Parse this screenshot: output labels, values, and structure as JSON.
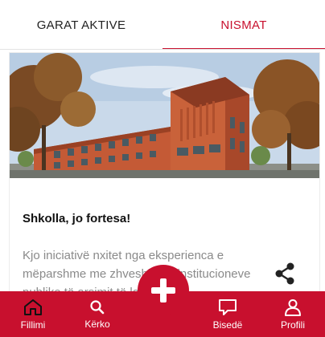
{
  "tabs": {
    "left_label": "GARAT AKTIVE",
    "right_label": "NISMAT",
    "active": "NISMAT"
  },
  "card": {
    "title": "Shkolla, jo fortesa!",
    "excerpt": "Kjo iniciativë nxitet nga eksperienca e mëparshme me zhveshjen e institucioneve publike të arsimit të lartë",
    "share_icon": "share-icon",
    "image_description_icon": "school-building-image"
  },
  "fab": {
    "icon": "plus-icon"
  },
  "bottom_nav": {
    "items": [
      {
        "label": "Fillimi",
        "icon": "home-icon",
        "active": true
      },
      {
        "label": "Kërko",
        "icon": "search-icon",
        "active": false
      },
      {
        "label": "Bisedë",
        "icon": "chat-icon",
        "active": false
      },
      {
        "label": "Profili",
        "icon": "user-icon",
        "active": false
      }
    ]
  },
  "colors": {
    "accent": "#c8102e",
    "tab_text": "#222222",
    "excerpt_text": "#8a8a8a"
  }
}
